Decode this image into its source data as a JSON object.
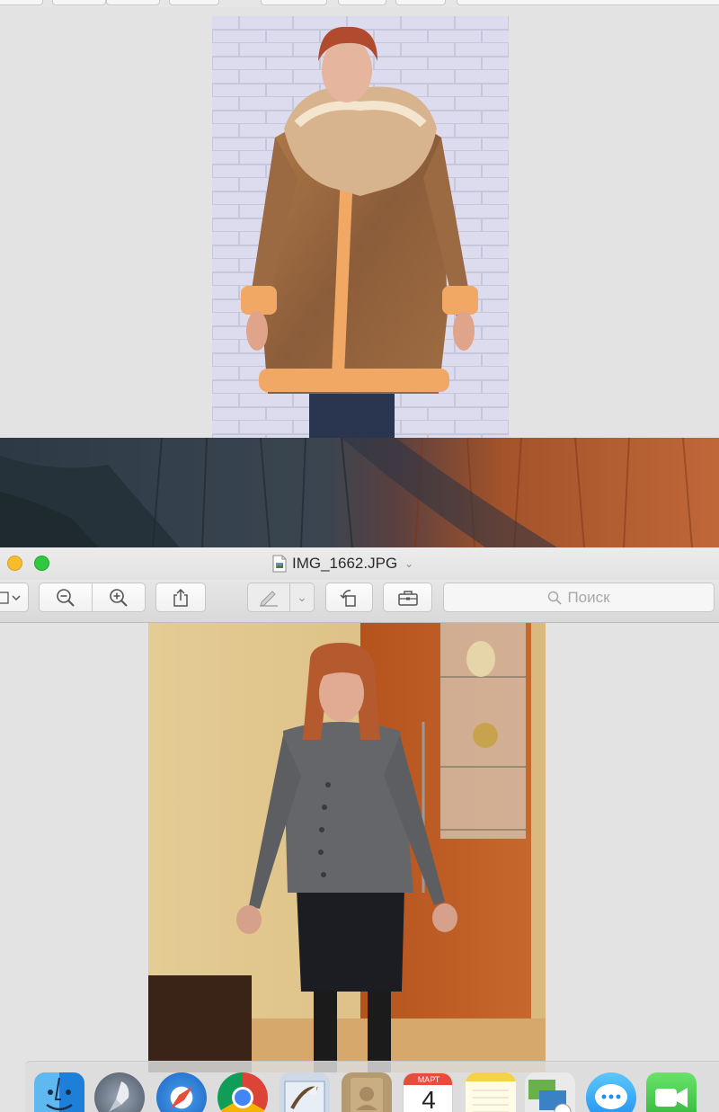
{
  "window": {
    "title": "IMG_1662.JPG",
    "title_chevron": "⌄"
  },
  "toolbar": {
    "sidebar_toggle_chevron": "⌄",
    "markup_chevron": "⌄",
    "search_placeholder": "Поиск"
  },
  "dock": {
    "items": [
      {
        "name": "Finder",
        "icon": "finder-icon"
      },
      {
        "name": "Launchpad",
        "icon": "launchpad-icon"
      },
      {
        "name": "Safari",
        "icon": "safari-icon"
      },
      {
        "name": "Chrome",
        "icon": "chrome-icon"
      },
      {
        "name": "Mail",
        "icon": "mail-icon"
      },
      {
        "name": "Contacts",
        "icon": "contacts-icon"
      },
      {
        "name": "Calendar",
        "icon": "calendar-icon"
      },
      {
        "name": "Notes",
        "icon": "notes-icon"
      },
      {
        "name": "Photos",
        "icon": "photos-icon"
      },
      {
        "name": "Messages",
        "icon": "messages-icon"
      },
      {
        "name": "FaceTime",
        "icon": "facetime-icon"
      }
    ],
    "calendar_month": "МАРТ",
    "calendar_day": "4"
  },
  "colors": {
    "traffic_yellow": "#f5bd2f",
    "traffic_green": "#2fc840"
  }
}
